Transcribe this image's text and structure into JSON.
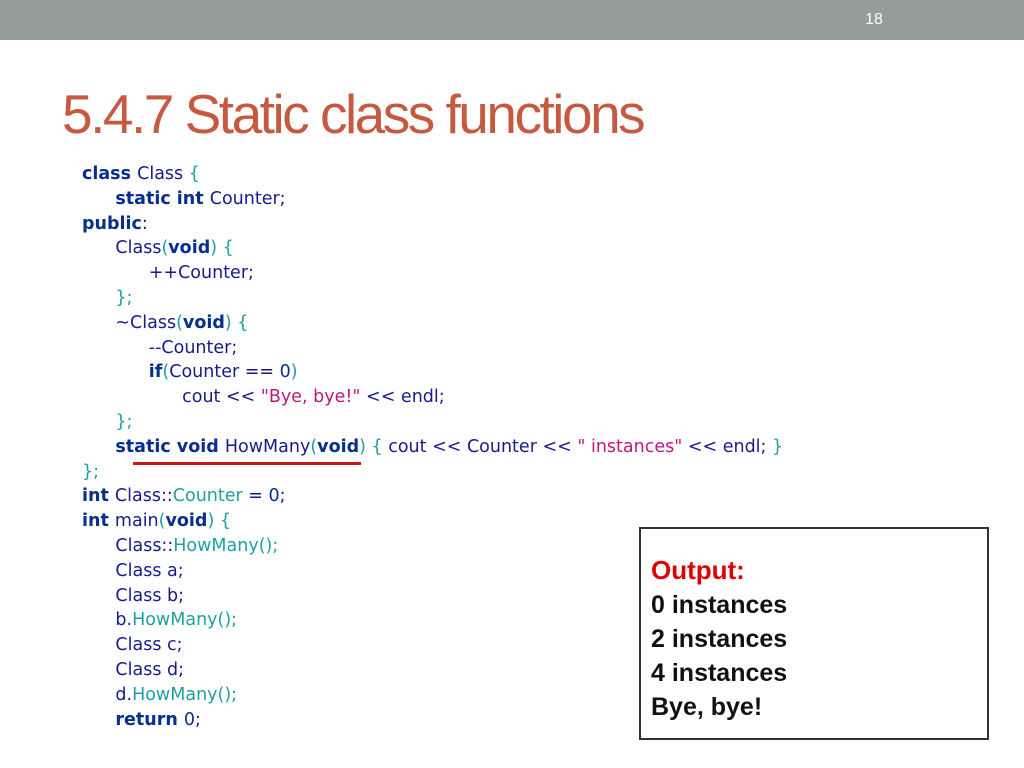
{
  "slide_number": "18",
  "title": "5.4.7 Static class functions",
  "code_lines": [
    [
      {
        "t": "class ",
        "c": "kw"
      },
      {
        "t": "Class ",
        "c": "id"
      },
      {
        "t": "{",
        "c": "br"
      }
    ],
    [
      {
        "t": "      "
      },
      {
        "t": "static int ",
        "c": "kw"
      },
      {
        "t": "Counter;",
        "c": "id"
      }
    ],
    [
      {
        "t": "public",
        "c": "kw"
      },
      {
        "t": ":",
        "c": "id"
      }
    ],
    [
      {
        "t": "      "
      },
      {
        "t": "Class",
        "c": "id"
      },
      {
        "t": "(",
        "c": "br"
      },
      {
        "t": "void",
        "c": "kw"
      },
      {
        "t": ") {",
        "c": "br"
      }
    ],
    [
      {
        "t": "            "
      },
      {
        "t": "++Counter;",
        "c": "id"
      }
    ],
    [
      {
        "t": "      "
      },
      {
        "t": "};",
        "c": "br"
      }
    ],
    [
      {
        "t": "      "
      },
      {
        "t": "~Class",
        "c": "id"
      },
      {
        "t": "(",
        "c": "br"
      },
      {
        "t": "void",
        "c": "kw"
      },
      {
        "t": ") {",
        "c": "br"
      }
    ],
    [
      {
        "t": "            "
      },
      {
        "t": "--Counter;",
        "c": "id"
      }
    ],
    [
      {
        "t": "            "
      },
      {
        "t": "if",
        "c": "kw"
      },
      {
        "t": "(",
        "c": "br"
      },
      {
        "t": "Counter == ",
        "c": "id"
      },
      {
        "t": "0",
        "c": "num"
      },
      {
        "t": ")",
        "c": "br"
      }
    ],
    [
      {
        "t": "                  "
      },
      {
        "t": "cout << ",
        "c": "id"
      },
      {
        "t": "\"Bye, bye!\"",
        "c": "str"
      },
      {
        "t": " << endl;",
        "c": "id"
      }
    ],
    [
      {
        "t": "      "
      },
      {
        "t": "};",
        "c": "br"
      }
    ],
    [
      {
        "t": "      "
      },
      {
        "t": "static void ",
        "c": "kw"
      },
      {
        "t": "HowMany",
        "c": "id"
      },
      {
        "t": "(",
        "c": "br"
      },
      {
        "t": "void",
        "c": "kw"
      },
      {
        "t": ") { ",
        "c": "br"
      },
      {
        "t": "cout << Counter << ",
        "c": "id"
      },
      {
        "t": "\" instances\"",
        "c": "str"
      },
      {
        "t": " << endl; ",
        "c": "id"
      },
      {
        "t": "}",
        "c": "br"
      }
    ],
    [
      {
        "t": "};",
        "c": "br"
      }
    ],
    [
      {
        "t": "int ",
        "c": "kw"
      },
      {
        "t": "Class::",
        "c": "id"
      },
      {
        "t": "Counter",
        "c": "fn"
      },
      {
        "t": " = ",
        "c": "id"
      },
      {
        "t": "0",
        "c": "num"
      },
      {
        "t": ";",
        "c": "id"
      }
    ],
    [
      {
        "t": "int ",
        "c": "kw"
      },
      {
        "t": "main",
        "c": "id"
      },
      {
        "t": "(",
        "c": "br"
      },
      {
        "t": "void",
        "c": "kw"
      },
      {
        "t": ") {",
        "c": "br"
      }
    ],
    [
      {
        "t": "      "
      },
      {
        "t": "Class::",
        "c": "id"
      },
      {
        "t": "HowMany",
        "c": "fn"
      },
      {
        "t": "();",
        "c": "br"
      }
    ],
    [
      {
        "t": "      "
      },
      {
        "t": "Class a;",
        "c": "id"
      }
    ],
    [
      {
        "t": "      "
      },
      {
        "t": "Class b;",
        "c": "id"
      }
    ],
    [
      {
        "t": "      "
      },
      {
        "t": "b.",
        "c": "id"
      },
      {
        "t": "HowMany",
        "c": "fn"
      },
      {
        "t": "();",
        "c": "br"
      }
    ],
    [
      {
        "t": "      "
      },
      {
        "t": "Class c;",
        "c": "id"
      }
    ],
    [
      {
        "t": "      "
      },
      {
        "t": "Class d;",
        "c": "id"
      }
    ],
    [
      {
        "t": "      "
      },
      {
        "t": "d.",
        "c": "id"
      },
      {
        "t": "HowMany",
        "c": "fn"
      },
      {
        "t": "();",
        "c": "br"
      }
    ],
    [
      {
        "t": "      "
      },
      {
        "t": "return ",
        "c": "kw"
      },
      {
        "t": "0",
        "c": "num"
      },
      {
        "t": ";",
        "c": "id"
      }
    ]
  ],
  "output": {
    "title": "Output:",
    "lines": [
      "0 instances",
      "2 instances",
      "4 instances",
      "Bye, bye!"
    ]
  },
  "colors": {
    "topbar": "#949e98",
    "title": "#c55a40",
    "keyword": "#0a2e8f",
    "identifier": "#1a1a8a",
    "bracket": "#1ea0a0",
    "string": "#c0187a",
    "underline": "#d11616",
    "output_title": "#e00000"
  }
}
